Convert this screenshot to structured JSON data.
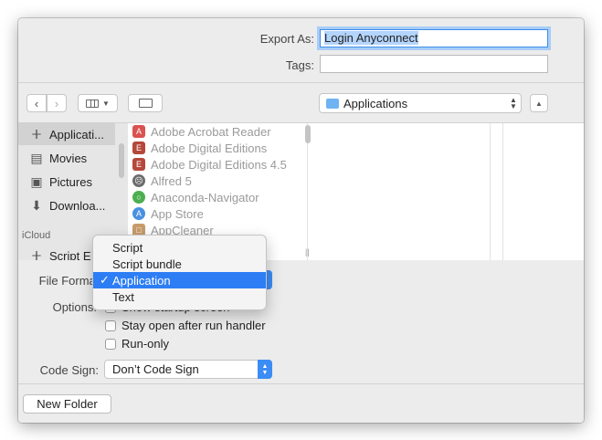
{
  "export": {
    "label": "Export As:",
    "value": "Login Anyconnect"
  },
  "tags": {
    "label": "Tags:",
    "value": ""
  },
  "toolbar": {
    "back_icon": "chevron-left",
    "forward_icon": "chevron-right",
    "view_icon": "columns",
    "new_folder_icon": "folder-plus",
    "location": "Applications",
    "collapse_icon": "chevron-up"
  },
  "sidebar": {
    "items": [
      {
        "label": "Applicati...",
        "icon": "applications-icon",
        "selected": true
      },
      {
        "label": "Movies",
        "icon": "film-icon"
      },
      {
        "label": "Pictures",
        "icon": "camera-icon"
      },
      {
        "label": "Downloa...",
        "icon": "download-icon"
      }
    ],
    "icloud_header": "iCloud",
    "icloud_items": [
      {
        "label": "Script E",
        "icon": "applications-icon"
      }
    ]
  },
  "files": [
    {
      "name": "Adobe Acrobat Reader",
      "icon_color": "#d9534f"
    },
    {
      "name": "Adobe Digital Editions",
      "icon_color": "#b5473b"
    },
    {
      "name": "Adobe Digital Editions 4.5",
      "icon_color": "#b5473b"
    },
    {
      "name": "Alfred 5",
      "icon_color": "#6d6d6d"
    },
    {
      "name": "Anaconda-Navigator",
      "icon_color": "#4caf50"
    },
    {
      "name": "App Store",
      "icon_color": "#4a90e2"
    },
    {
      "name": "AppCleaner",
      "icon_color": "#c89b6a"
    }
  ],
  "format": {
    "label": "File Format:"
  },
  "format_menu": {
    "items": [
      "Script",
      "Script bundle",
      "Application",
      "Text"
    ],
    "selected": "Application",
    "check": "✓"
  },
  "options": {
    "label": "Options:",
    "items": [
      {
        "label": "Show startup screen",
        "checked": false
      },
      {
        "label": "Stay open after run handler",
        "checked": false
      },
      {
        "label": "Run-only",
        "checked": false
      }
    ]
  },
  "codesign": {
    "label": "Code Sign:",
    "value": "Don’t Code Sign"
  },
  "new_folder_button": "New Folder",
  "colors": {
    "accent": "#2d7ef5",
    "focus": "#a8cdf7"
  }
}
